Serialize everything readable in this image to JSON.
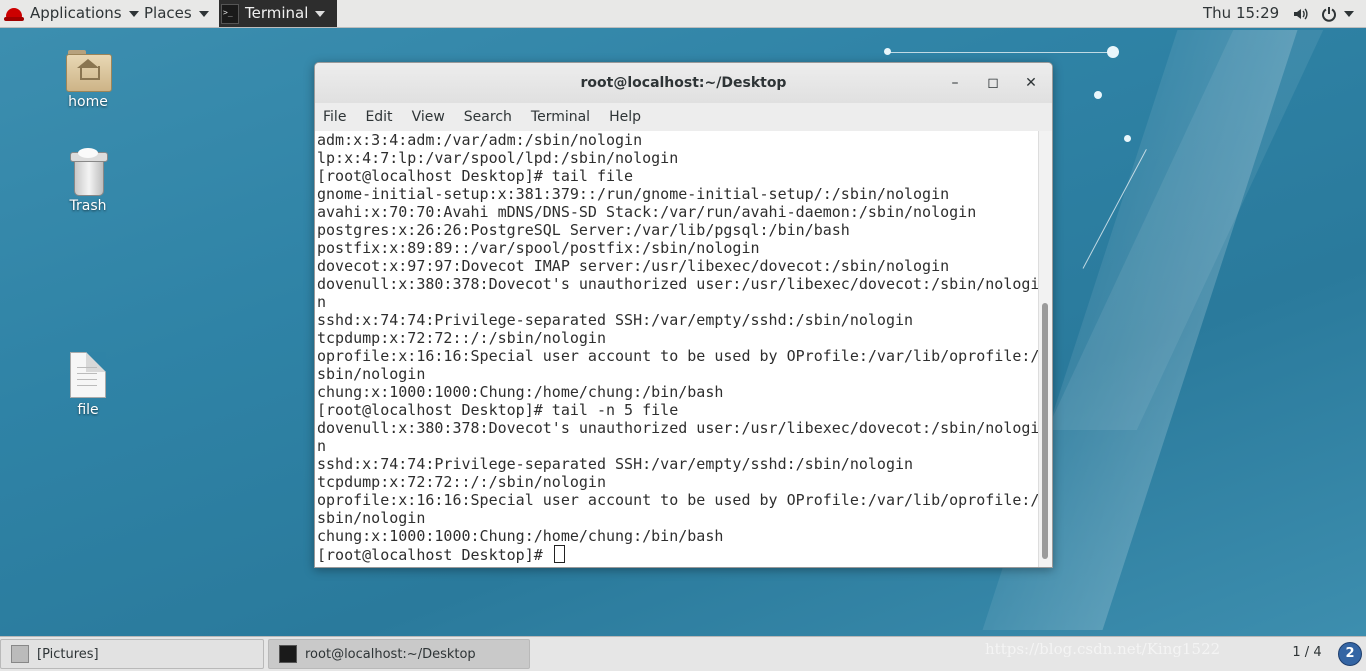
{
  "topbar": {
    "applications": "Applications",
    "places": "Places",
    "terminal_app": "Terminal",
    "clock": "Thu 15:29",
    "volume_icon": "volume-icon",
    "power_icon": "power-icon"
  },
  "desktop": {
    "icons": [
      {
        "label": "home",
        "icon": "home-folder-icon"
      },
      {
        "label": "Trash",
        "icon": "trash-icon"
      },
      {
        "label": "file",
        "icon": "text-file-icon"
      }
    ]
  },
  "window": {
    "title": "root@localhost:~/Desktop",
    "minimize": "–",
    "maximize": "◻",
    "close": "✕",
    "menu": [
      "File",
      "Edit",
      "View",
      "Search",
      "Terminal",
      "Help"
    ]
  },
  "terminal": {
    "lines": [
      "adm:x:3:4:adm:/var/adm:/sbin/nologin",
      "lp:x:4:7:lp:/var/spool/lpd:/sbin/nologin",
      "[root@localhost Desktop]# tail file",
      "gnome-initial-setup:x:381:379::/run/gnome-initial-setup/:/sbin/nologin",
      "avahi:x:70:70:Avahi mDNS/DNS-SD Stack:/var/run/avahi-daemon:/sbin/nologin",
      "postgres:x:26:26:PostgreSQL Server:/var/lib/pgsql:/bin/bash",
      "postfix:x:89:89::/var/spool/postfix:/sbin/nologin",
      "dovecot:x:97:97:Dovecot IMAP server:/usr/libexec/dovecot:/sbin/nologin",
      "dovenull:x:380:378:Dovecot's unauthorized user:/usr/libexec/dovecot:/sbin/nologi",
      "n",
      "sshd:x:74:74:Privilege-separated SSH:/var/empty/sshd:/sbin/nologin",
      "tcpdump:x:72:72::/:/sbin/nologin",
      "oprofile:x:16:16:Special user account to be used by OProfile:/var/lib/oprofile:/",
      "sbin/nologin",
      "chung:x:1000:1000:Chung:/home/chung:/bin/bash",
      "[root@localhost Desktop]# tail -n 5 file",
      "dovenull:x:380:378:Dovecot's unauthorized user:/usr/libexec/dovecot:/sbin/nologi",
      "n",
      "sshd:x:74:74:Privilege-separated SSH:/var/empty/sshd:/sbin/nologin",
      "tcpdump:x:72:72::/:/sbin/nologin",
      "oprofile:x:16:16:Special user account to be used by OProfile:/var/lib/oprofile:/",
      "sbin/nologin",
      "chung:x:1000:1000:Chung:/home/chung:/bin/bash"
    ],
    "prompt": "[root@localhost Desktop]# "
  },
  "taskbar": {
    "items": [
      {
        "label": "[Pictures]"
      },
      {
        "label": "root@localhost:~/Desktop"
      }
    ],
    "watermark": "https://blog.csdn.net/King1522",
    "workspace": "1 / 4",
    "badge": "2"
  }
}
